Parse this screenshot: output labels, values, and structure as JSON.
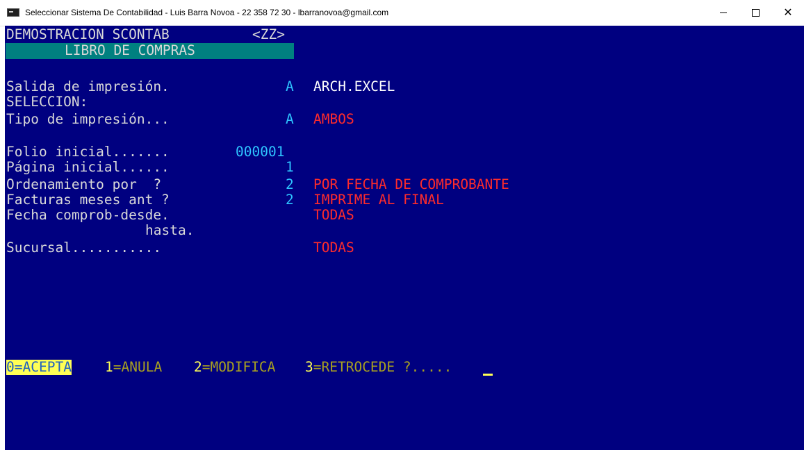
{
  "window": {
    "title": "Seleccionar Sistema De Contabilidad - Luis Barra Novoa - 22 358 72 30 - lbarranovoa@gmail.com",
    "minimize": "–",
    "maximize": "☐",
    "close": "✕"
  },
  "header": {
    "company": "DEMOSTRACION SCONTAB",
    "code": "<ZZ>",
    "report": "LIBRO DE COMPRAS"
  },
  "form": {
    "salida_label": "Salida de impresión.",
    "salida_code": "A",
    "salida_value": "ARCH.EXCEL",
    "seleccion_label": "SELECCION:",
    "tipo_label": "Tipo de impresión...",
    "tipo_code": "A",
    "tipo_value": "AMBOS",
    "folio_label": "Folio inicial.......",
    "folio_value": "000001",
    "pagina_label": "Página inicial......",
    "pagina_value": "1",
    "orden_label": "Ordenamiento por  ?",
    "orden_code": "2",
    "orden_value": "POR FECHA DE COMPROBANTE",
    "facturas_label": "Facturas meses ant ?",
    "facturas_code": "2",
    "facturas_value": "IMPRIME AL FINAL",
    "fecha_desde_label": "Fecha comprob-desde.",
    "fecha_value": "TODAS",
    "fecha_hasta_label": "hasta.",
    "sucursal_label": "Sucursal...........",
    "sucursal_value": "TODAS"
  },
  "footer": {
    "opt0_key": "0",
    "opt0_label": "=ACEPTA",
    "opt1_key": "1",
    "opt1_label": "=ANULA",
    "opt2_key": "2",
    "opt2_label": "=MODIFICA",
    "opt3_key": "3",
    "opt3_label": "=RETROCEDE ?....."
  }
}
